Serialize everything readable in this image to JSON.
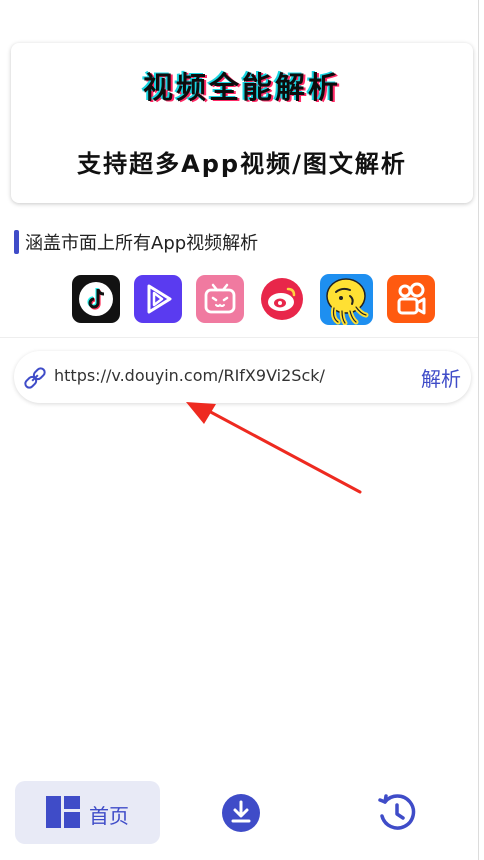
{
  "banner": {
    "title": "视频全能解析",
    "subtitle": "支持超多App视频/图文解析"
  },
  "section": {
    "title": "涵盖市面上所有App视频解析"
  },
  "apps": [
    {
      "icon": "tiktok-icon",
      "color": "#121212"
    },
    {
      "icon": "video-play-icon",
      "color": "#5a3bf0"
    },
    {
      "icon": "bilibili-icon",
      "color": "#f07aa0"
    },
    {
      "icon": "weibo-icon",
      "color": "#e8264a"
    },
    {
      "icon": "yellow-mascot-icon",
      "color": "#1e8ff0"
    },
    {
      "icon": "kuaishou-icon",
      "color": "#ff5a10"
    }
  ],
  "url_input": {
    "value": "https://v.douyin.com/RIfX9Vi2Sck/",
    "parse_label": "解析"
  },
  "nav": {
    "home_label": "首页"
  },
  "colors": {
    "accent": "#3f4cc8",
    "nav_active_bg": "#e8eaf6",
    "arrow": "#ee2a20"
  }
}
